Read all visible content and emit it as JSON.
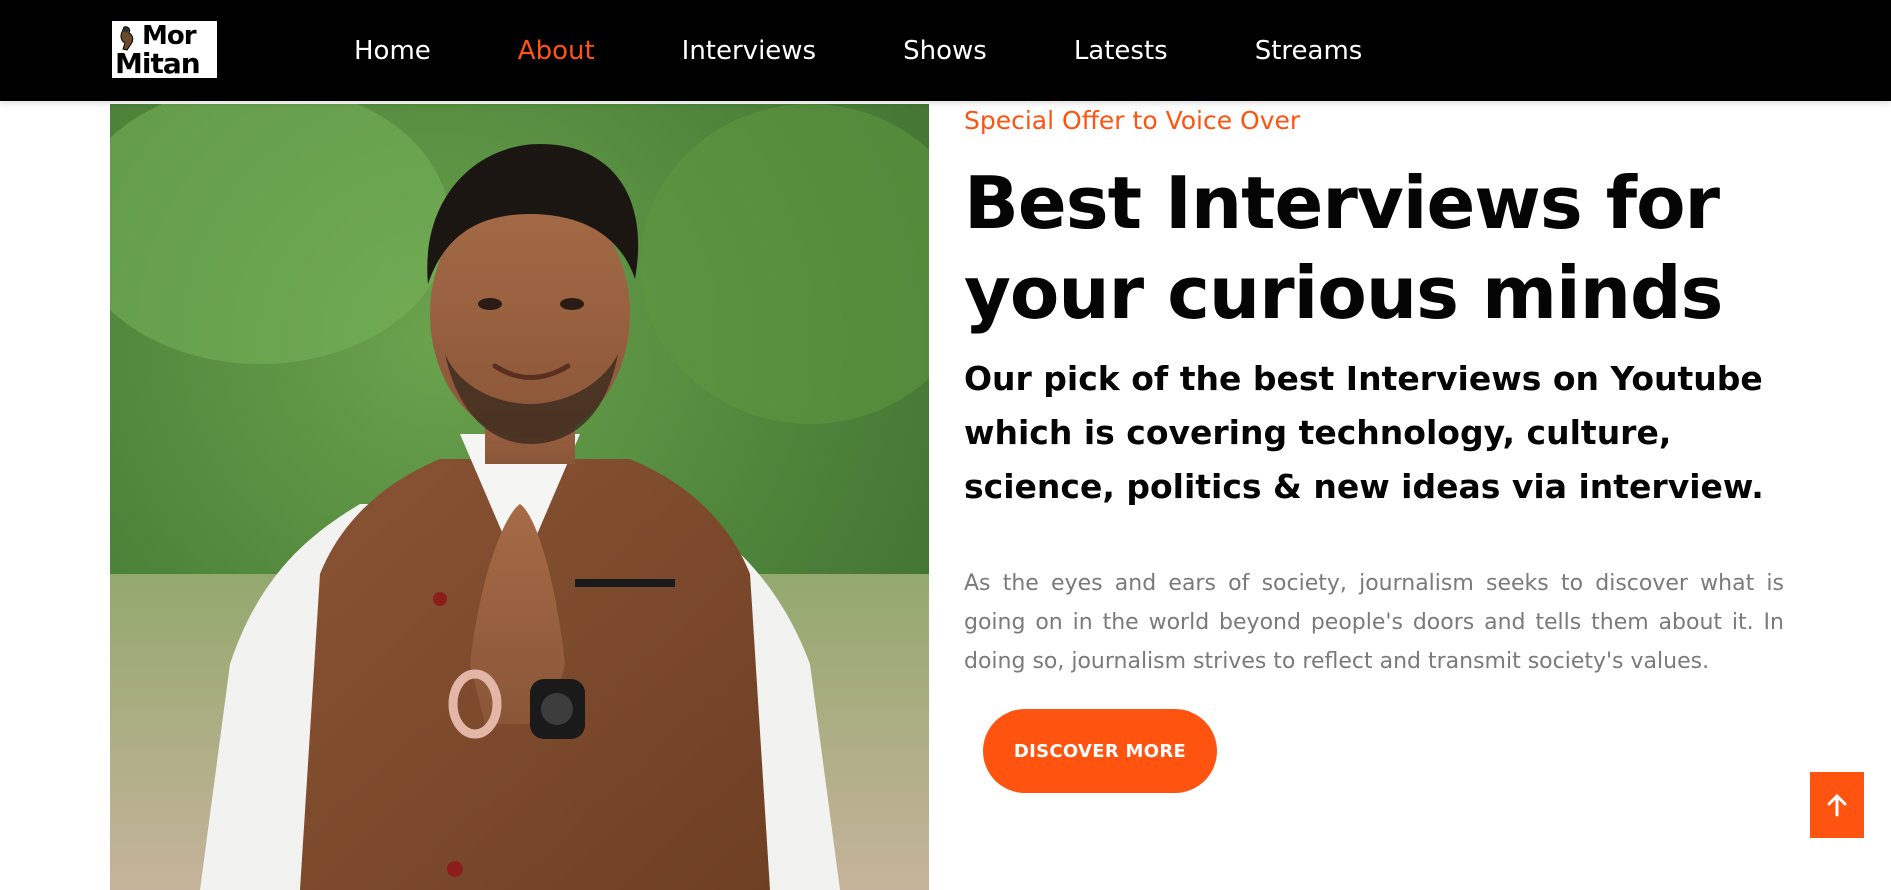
{
  "brand": {
    "logo_text_line1": "Mor",
    "logo_text_line2": "Mitan"
  },
  "nav": {
    "items": [
      {
        "label": "Home",
        "active": false
      },
      {
        "label": "About",
        "active": true
      },
      {
        "label": "Interviews",
        "active": false
      },
      {
        "label": "Shows",
        "active": false
      },
      {
        "label": "Latests",
        "active": false
      },
      {
        "label": "Streams",
        "active": false
      }
    ]
  },
  "hero": {
    "eyebrow": "Special Offer to Voice Over",
    "headline_line1": "Best Interviews for",
    "headline_line2": "your curious minds",
    "subhead": "Our pick of the best Interviews on Youtube which is covering technology, culture, science, politics & new ideas via interview.",
    "body": "As the eyes and ears of society, journalism seeks to discover what is going on in the world beyond people's doors and tells them about it. In doing so, journalism strives to reflect and transmit society's values.",
    "cta_label": "DISCOVER MORE"
  },
  "icons": {
    "scroll_top": "arrow-up-icon"
  },
  "colors": {
    "accent": "#ff5310",
    "nav_bg": "#000000",
    "text_dark": "#050505",
    "text_muted": "#7a7a7a"
  }
}
